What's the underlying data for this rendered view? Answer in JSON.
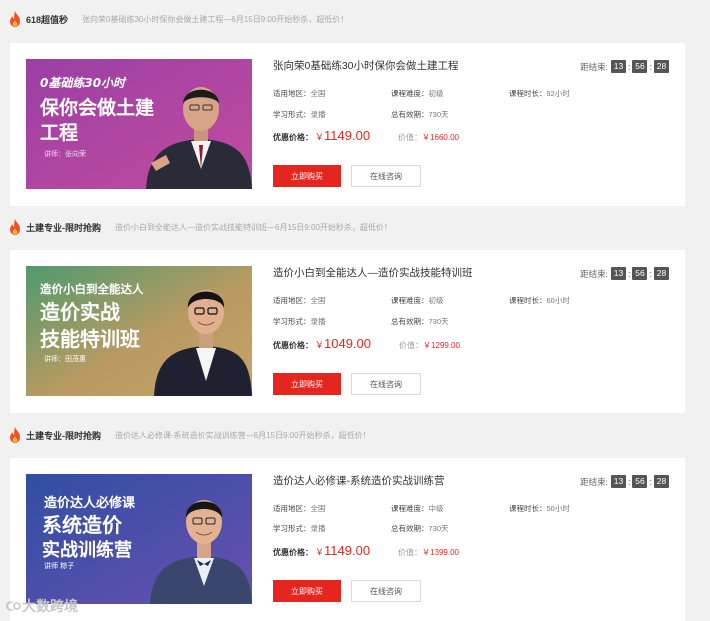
{
  "sections": [
    {
      "title": "618超值秒",
      "desc": "张向荣0基础练30小时保你会做土建工程—6月15日9:00开始秒杀，超低价！",
      "course": {
        "title": "张向荣0基础练30小时保你会做土建工程",
        "countdown_label": "距结束:",
        "countdown": [
          "13",
          "56",
          "28"
        ],
        "region_label": "适用地区：",
        "region": "全国",
        "difficulty_label": "课程难度：",
        "difficulty": "初级",
        "duration_label": "课程时长：",
        "duration": "92小时",
        "form_label": "学习形式：",
        "form": "录播",
        "validity_label": "总有效期：",
        "validity": "730天",
        "price_label": "优惠价格：",
        "currency": "￥",
        "price": "1149.00",
        "orig_label": "价值：",
        "orig_price": "￥1660.00",
        "buy_label": "立即购买",
        "consult_label": "在线咨询",
        "thumb": {
          "lines": [
            "0基础练30小时",
            "保你会做土建",
            "工程"
          ],
          "teacher": "讲师：张向荣",
          "bg1": "#9b3fa5",
          "bg2": "#c24c9e"
        }
      }
    },
    {
      "title": "土建专业-限时抢购",
      "desc": "造价小白到全能达人—造价实战技能特训班—6月15日9:00开始秒杀，超低价！",
      "course": {
        "title": "造价小白到全能达人—造价实战技能特训班",
        "countdown_label": "距结束:",
        "countdown": [
          "13",
          "56",
          "28"
        ],
        "region_label": "适用地区：",
        "region": "全国",
        "difficulty_label": "课程难度：",
        "difficulty": "初级",
        "duration_label": "课程时长：",
        "duration": "60小时",
        "form_label": "学习形式：",
        "form": "录播",
        "validity_label": "总有效期：",
        "validity": "730天",
        "price_label": "优惠价格：",
        "currency": "￥",
        "price": "1049.00",
        "orig_label": "价值：",
        "orig_price": "￥1299.00",
        "buy_label": "立即购买",
        "consult_label": "在线咨询",
        "thumb": {
          "lines": [
            "造价小白到全能达人",
            "造价实战",
            "技能特训班"
          ],
          "teacher": "讲师：田茂惠",
          "bg1": "#4f9a6e",
          "bg2": "#c7a267"
        }
      }
    },
    {
      "title": "土建专业-限时抢购",
      "desc": "造价达人必修课-系统造价实战训练营—6月15日9:00开始秒杀，超低价！",
      "course": {
        "title": "造价达人必修课-系统造价实战训练营",
        "countdown_label": "距结束:",
        "countdown": [
          "13",
          "56",
          "28"
        ],
        "region_label": "适用地区：",
        "region": "全国",
        "difficulty_label": "课程难度：",
        "difficulty": "中级",
        "duration_label": "课程时长：",
        "duration": "50小时",
        "form_label": "学习形式：",
        "form": "录播",
        "validity_label": "总有效期：",
        "validity": "730天",
        "price_label": "优惠价格：",
        "currency": "￥",
        "price": "1149.00",
        "orig_label": "价值：",
        "orig_price": "￥1399.00",
        "buy_label": "立即购买",
        "consult_label": "在线咨询",
        "thumb": {
          "lines": [
            "造价达人必修课",
            "系统造价",
            "实战训练营"
          ],
          "teacher": "讲师  粽子",
          "bg1": "#2f4fa3",
          "bg2": "#6a4fb0"
        }
      }
    }
  ],
  "watermark": "大数跨境",
  "colors": {
    "accent": "#e5261f",
    "flame": "#f04e23"
  }
}
